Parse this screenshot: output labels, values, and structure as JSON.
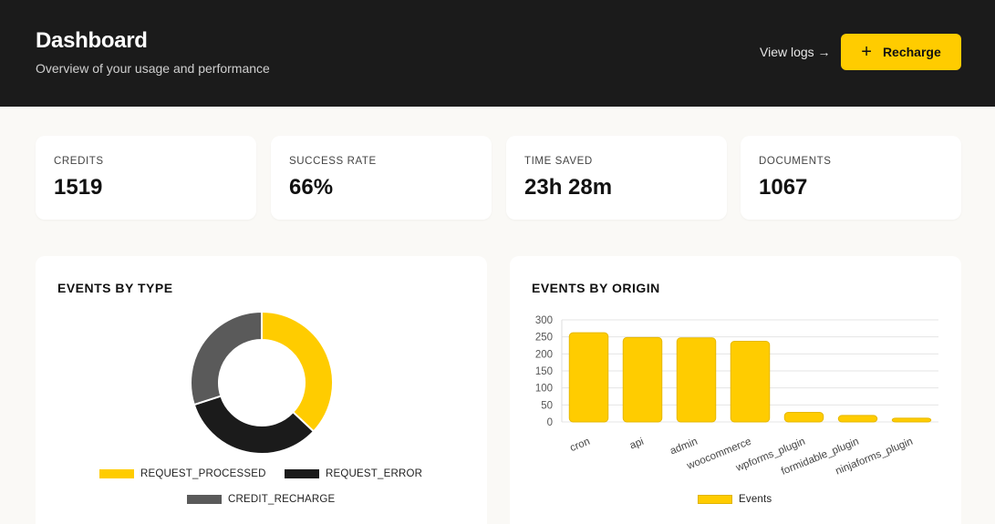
{
  "header": {
    "title": "Dashboard",
    "subtitle": "Overview of your usage and performance",
    "view_logs": "View logs →",
    "recharge_label": "Recharge"
  },
  "stats": [
    {
      "label": "CREDITS",
      "value": "1519"
    },
    {
      "label": "SUCCESS RATE",
      "value": "66%"
    },
    {
      "label": "TIME SAVED",
      "value": "23h 28m"
    },
    {
      "label": "DOCUMENTS",
      "value": "1067"
    }
  ],
  "events_by_type": {
    "title": "EVENTS BY TYPE"
  },
  "events_by_origin": {
    "title": "EVENTS BY ORIGIN"
  },
  "colors": {
    "accent": "#ffcc00",
    "dark": "#1b1b1b",
    "grey": "#5a5a5a"
  },
  "chart_data": [
    {
      "type": "pie",
      "title": "EVENTS BY TYPE",
      "categories": [
        "REQUEST_PROCESSED",
        "REQUEST_ERROR",
        "CREDIT_RECHARGE"
      ],
      "values": [
        37,
        33,
        30
      ],
      "colors": [
        "#ffcc00",
        "#1b1b1b",
        "#5a5a5a"
      ],
      "legend": "bottom"
    },
    {
      "type": "bar",
      "title": "EVENTS BY ORIGIN",
      "categories": [
        "cron",
        "api",
        "admin",
        "woocommerce",
        "wpforms_plugin",
        "formidable_plugin",
        "ninjaforms_plugin"
      ],
      "series": [
        {
          "name": "Events",
          "values": [
            262,
            248,
            247,
            237,
            28,
            19,
            11
          ]
        }
      ],
      "ylim": [
        0,
        300
      ],
      "yticks": [
        0,
        50,
        100,
        150,
        200,
        250,
        300
      ],
      "grid": true,
      "legend": "bottom"
    }
  ]
}
